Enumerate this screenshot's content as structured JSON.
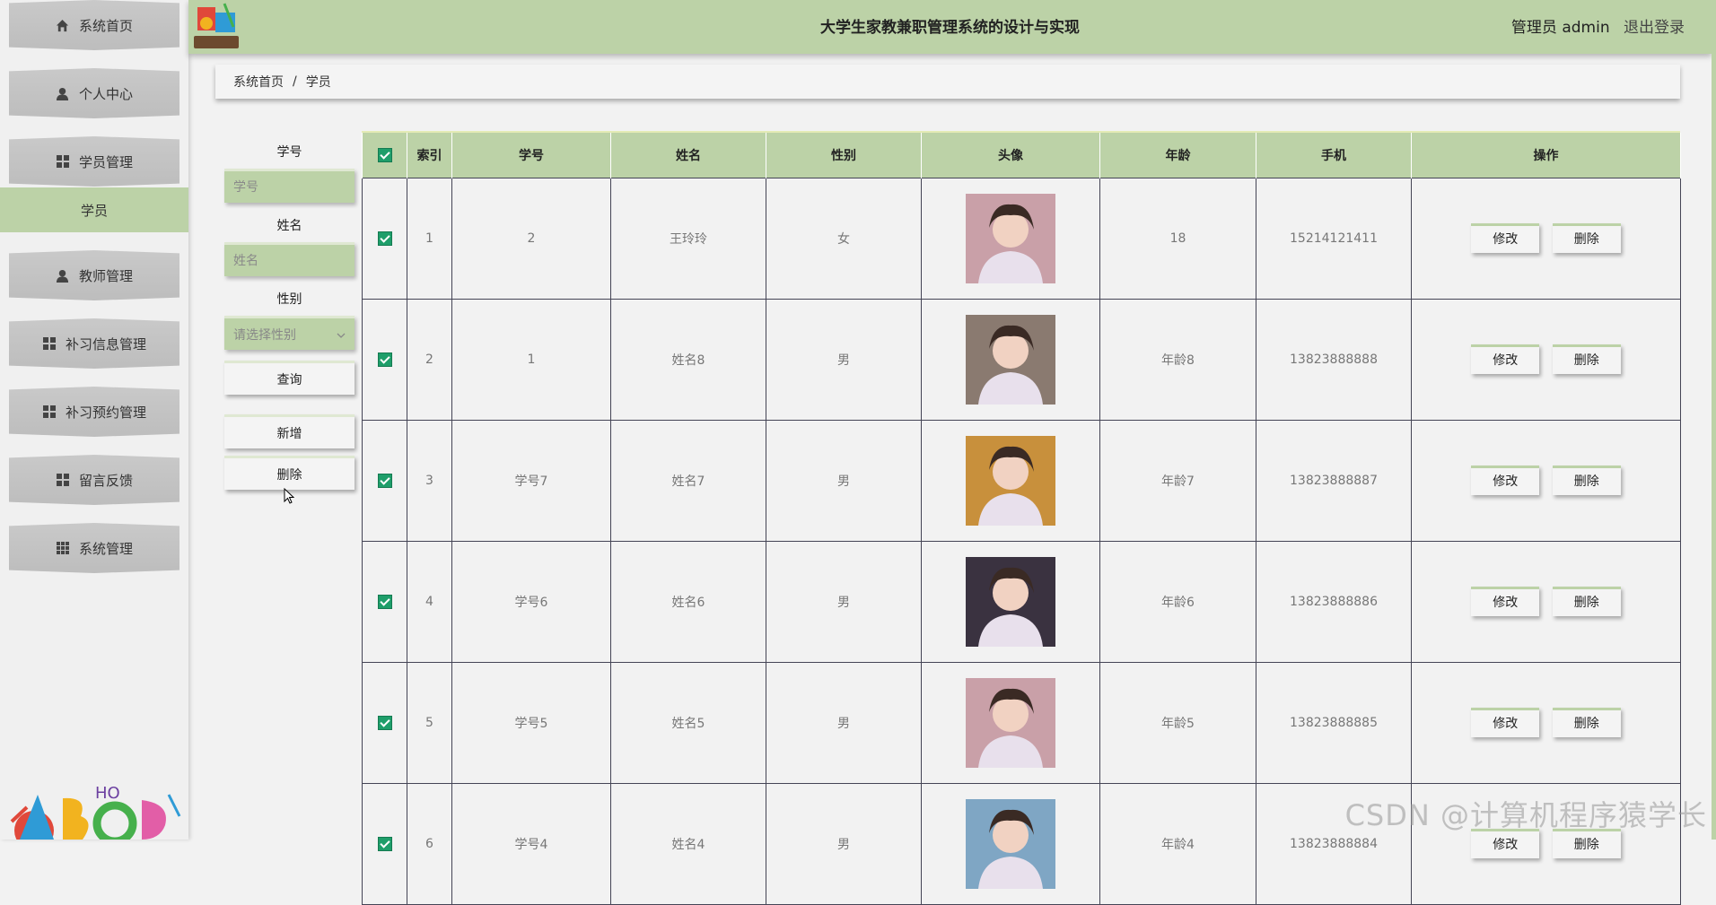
{
  "header": {
    "title": "大学生家教兼职管理系统的设计与实现",
    "user": "管理员 admin",
    "logout": "退出登录"
  },
  "sidebar": {
    "items": [
      {
        "label": "系统首页",
        "icon": "home-icon"
      },
      {
        "label": "个人中心",
        "icon": "user-icon"
      },
      {
        "label": "学员管理",
        "icon": "grid-icon"
      },
      {
        "label": "教师管理",
        "icon": "user-icon"
      },
      {
        "label": "补习信息管理",
        "icon": "grid-icon"
      },
      {
        "label": "补习预约管理",
        "icon": "grid-icon"
      },
      {
        "label": "留言反馈",
        "icon": "grid-icon"
      },
      {
        "label": "系统管理",
        "icon": "apps-icon"
      }
    ],
    "active_sub": "学员"
  },
  "breadcrumb": {
    "home": "系统首页",
    "separator": "/",
    "current": "学员"
  },
  "search": {
    "student_id_label": "学号",
    "student_id_placeholder": "学号",
    "name_label": "姓名",
    "name_placeholder": "姓名",
    "gender_label": "性别",
    "gender_placeholder": "请选择性别",
    "query": "查询",
    "add": "新增",
    "delete": "删除"
  },
  "table": {
    "columns": [
      "索引",
      "学号",
      "姓名",
      "性别",
      "头像",
      "年龄",
      "手机",
      "操作"
    ],
    "edit_label": "修改",
    "delete_label": "删除",
    "rows": [
      {
        "index": "1",
        "sid": "2",
        "name": "王玲玲",
        "gender": "女",
        "age": "18",
        "phone": "15214121411",
        "avatar": "#c9a0a8"
      },
      {
        "index": "2",
        "sid": "1",
        "name": "姓名8",
        "gender": "男",
        "age": "年龄8",
        "phone": "13823888888",
        "avatar": "#8a7a70"
      },
      {
        "index": "3",
        "sid": "学号7",
        "name": "姓名7",
        "gender": "男",
        "age": "年龄7",
        "phone": "13823888887",
        "avatar": "#c8903c"
      },
      {
        "index": "4",
        "sid": "学号6",
        "name": "姓名6",
        "gender": "男",
        "age": "年龄6",
        "phone": "13823888886",
        "avatar": "#3a3240"
      },
      {
        "index": "5",
        "sid": "学号5",
        "name": "姓名5",
        "gender": "男",
        "age": "年龄5",
        "phone": "13823888885",
        "avatar": "#c9a0a8"
      },
      {
        "index": "6",
        "sid": "学号4",
        "name": "姓名4",
        "gender": "男",
        "age": "年龄4",
        "phone": "13823888884",
        "avatar": "#7fa6c4"
      }
    ]
  },
  "watermark": "CSDN @计算机程序猿学长",
  "colors": {
    "accent": "#bcd2a7",
    "checkbox": "#1e9e6a"
  }
}
